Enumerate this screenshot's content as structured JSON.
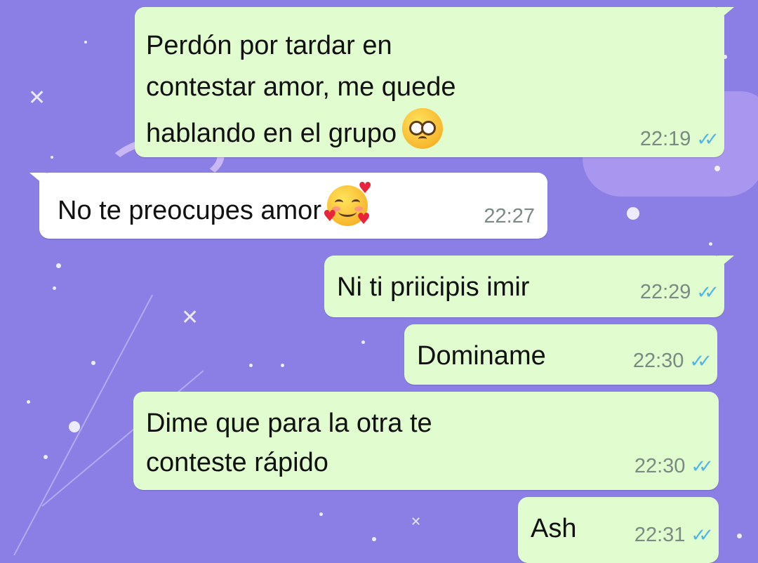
{
  "chat": {
    "messages": [
      {
        "direction": "outgoing",
        "lines": [
          "Perdón por tardar en",
          "contestar amor, me quede",
          "hablando en el grupo"
        ],
        "emoji": "pleading-face",
        "time": "22:19",
        "status": "read"
      },
      {
        "direction": "incoming",
        "lines": [
          "No te preocupes amor"
        ],
        "emoji": "smiling-face-with-hearts",
        "time": "22:27"
      },
      {
        "direction": "outgoing",
        "lines": [
          "Ni ti priicipis imir"
        ],
        "time": "22:29",
        "status": "read"
      },
      {
        "direction": "outgoing",
        "lines": [
          "Dominame"
        ],
        "time": "22:30",
        "status": "read"
      },
      {
        "direction": "outgoing",
        "lines": [
          "Dime que para la otra te",
          "conteste rápido"
        ],
        "time": "22:30",
        "status": "read"
      },
      {
        "direction": "outgoing",
        "lines": [
          "Ash"
        ],
        "time": "22:31",
        "status": "read"
      }
    ],
    "tick_glyph": "✓✓"
  },
  "colors": {
    "wallpaper": "#8b7fe6",
    "outgoing_bubble": "#e1fccf",
    "incoming_bubble": "#ffffff",
    "read_ticks": "#4fb6ec",
    "timestamp": "#7b8a82"
  },
  "icons": {
    "read_receipt": "double-check-icon",
    "emoji_1": "pleading-face-emoji",
    "emoji_2": "smiling-face-with-hearts-emoji"
  }
}
